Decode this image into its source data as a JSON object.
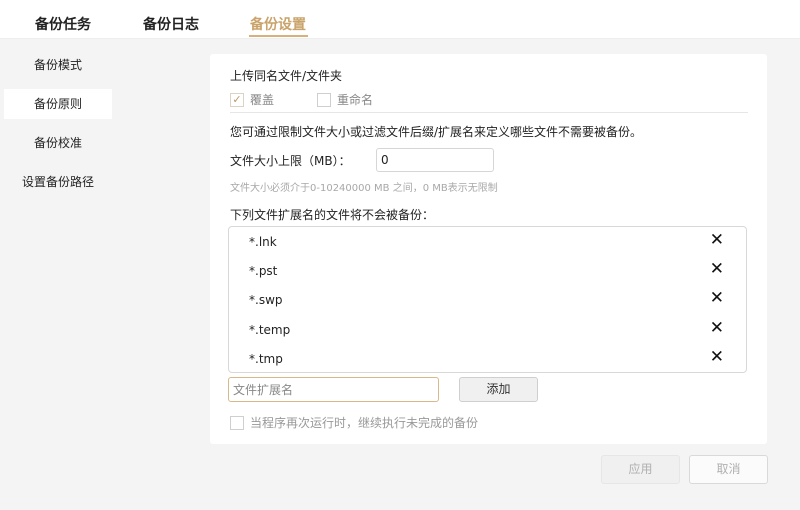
{
  "tabs": [
    {
      "label": "备份任务"
    },
    {
      "label": "备份日志"
    },
    {
      "label": "备份设置",
      "active": true
    }
  ],
  "sidebar": {
    "items": [
      {
        "label": "备份模式"
      },
      {
        "label": "备份原则",
        "active": true
      },
      {
        "label": "备份校准"
      },
      {
        "label": "设置备份路径"
      }
    ]
  },
  "settings": {
    "same_name_title": "上传同名文件/文件夹",
    "overwrite_label": "覆盖",
    "overwrite_checked": true,
    "rename_label": "重命名",
    "rename_checked": false,
    "description": "您可通过限制文件大小或过滤文件后缀/扩展名来定义哪些文件不需要被备份。",
    "size_limit_label": "文件大小上限（MB）：",
    "size_limit_value": "0",
    "size_hint": "文件大小必须介于0-10240000 MB 之间，0 MB表示无限制",
    "ext_list_title": "下列文件扩展名的文件将不会被备份：",
    "extensions": [
      "*.lnk",
      "*.pst",
      "*.swp",
      "*.temp",
      "*.tmp"
    ],
    "ext_input_placeholder": "文件扩展名",
    "add_button": "添加",
    "resume_label": "当程序再次运行时，继续执行未完成的备份",
    "resume_checked": false
  },
  "footer": {
    "apply_button": "应用",
    "cancel_button": "取消"
  },
  "colors": {
    "accent": "#c9a36a",
    "accent_underline": "#d7b27c",
    "input_focus_border": "#d8b98a"
  },
  "icons": {
    "delete": "close-icon",
    "check": "check-icon"
  }
}
